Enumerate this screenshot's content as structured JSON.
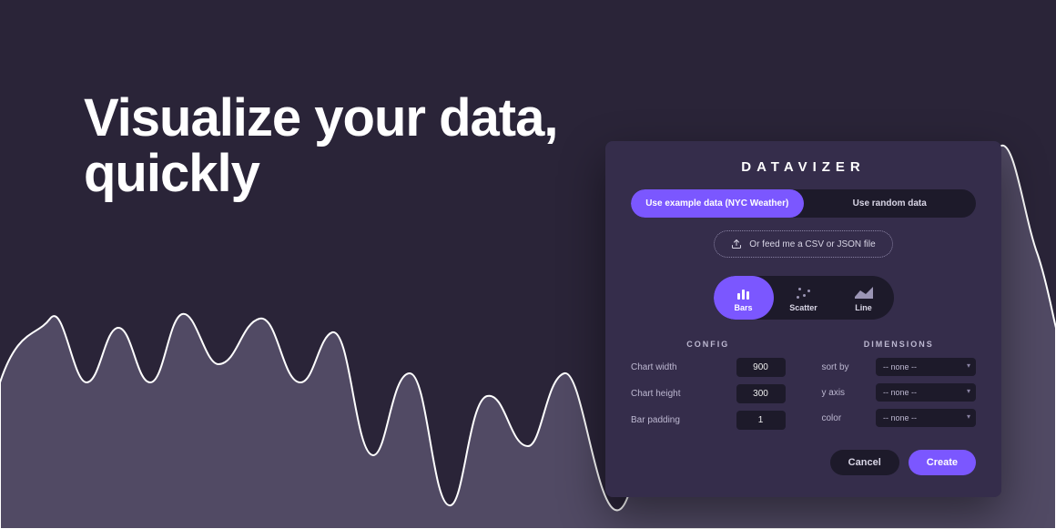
{
  "headline": {
    "line1": "Visualize your data,",
    "line2": "quickly"
  },
  "panel": {
    "brand": "DATAVIZER",
    "data_source": {
      "example_label": "Use example data (NYC Weather)",
      "random_label": "Use random data",
      "upload_label": "Or feed me a CSV or JSON file"
    },
    "chart_types": {
      "bars": "Bars",
      "scatter": "Scatter",
      "line": "Line"
    },
    "config": {
      "heading": "CONFIG",
      "chart_width": {
        "label": "Chart width",
        "value": "900"
      },
      "chart_height": {
        "label": "Chart height",
        "value": "300"
      },
      "bar_padding": {
        "label": "Bar padding",
        "value": "1"
      }
    },
    "dimensions": {
      "heading": "DIMENSIONS",
      "sort_by": {
        "label": "sort by",
        "value": "-- none --"
      },
      "y_axis": {
        "label": "y axis",
        "value": "-- none --"
      },
      "color": {
        "label": "color",
        "value": "-- none --"
      }
    },
    "actions": {
      "cancel": "Cancel",
      "create": "Create"
    }
  }
}
